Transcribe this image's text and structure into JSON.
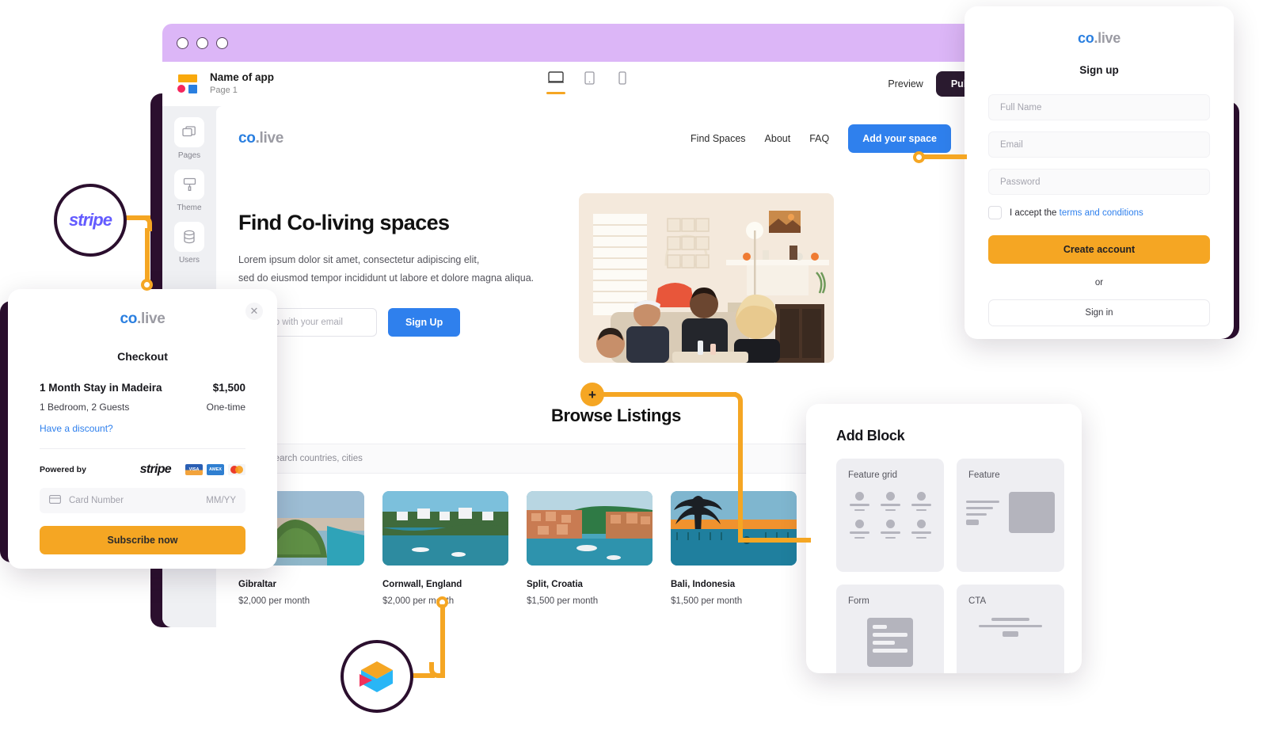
{
  "editor": {
    "window_controls": [
      "close",
      "minimize",
      "maximize"
    ],
    "app_name": "Name of app",
    "page_label": "Page 1",
    "devices": [
      {
        "name": "desktop",
        "active": true
      },
      {
        "name": "tablet",
        "active": false
      },
      {
        "name": "mobile",
        "active": false
      }
    ],
    "preview_label": "Preview",
    "publish_label": "Publish",
    "sidebar": [
      {
        "label": "Pages",
        "icon": "pages-icon"
      },
      {
        "label": "Theme",
        "icon": "theme-brush-icon"
      },
      {
        "label": "Users",
        "icon": "users-database-icon"
      }
    ]
  },
  "site": {
    "brand": {
      "co": "co",
      "live": ".live"
    },
    "nav": [
      {
        "label": "Find Spaces"
      },
      {
        "label": "About"
      },
      {
        "label": "FAQ"
      }
    ],
    "cta_label": "Add your space",
    "hero": {
      "heading": "Find Co-living spaces",
      "paragraph_line1": "Lorem ipsum dolor sit amet, consectetur adipiscing elit,",
      "paragraph_line2": "sed do eiusmod tempor incididunt ut labore et dolore magna aliqua.",
      "email_placeholder": "Sign up with your email",
      "signup_label": "Sign Up"
    },
    "browse": {
      "title": "Browse Listings",
      "search_placeholder": "Search countries, cities",
      "listings": [
        {
          "name": "Gibraltar",
          "price": "$2,000 per month"
        },
        {
          "name": "Cornwall, England",
          "price": "$2,000 per month"
        },
        {
          "name": "Split, Croatia",
          "price": "$1,500 per month"
        },
        {
          "name": "Bali, Indonesia",
          "price": "$1,500 per month"
        }
      ]
    }
  },
  "checkout": {
    "brand": {
      "co": "co",
      "live": ".live"
    },
    "close_icon": "close-icon",
    "title": "Checkout",
    "item_name": "1 Month Stay in Madeira",
    "item_price": "$1,500",
    "item_detail": "1 Bedroom, 2 Guests",
    "item_frequency": "One-time",
    "discount_link": "Have a discount?",
    "powered_by": "Powered by",
    "stripe_label": "stripe",
    "card_brands": [
      "VISA",
      "AMEX",
      "mastercard"
    ],
    "card_placeholder": "Card Number",
    "expiry_placeholder": "MM/YY",
    "subscribe_label": "Subscribe now"
  },
  "signup": {
    "brand": {
      "co": "co",
      "live": ".live"
    },
    "title": "Sign up",
    "fields": [
      {
        "placeholder": "Full Name"
      },
      {
        "placeholder": "Email"
      },
      {
        "placeholder": "Password"
      }
    ],
    "terms_prefix": "I accept the ",
    "terms_link": "terms and conditions",
    "create_label": "Create account",
    "or_label": "or",
    "signin_label": "Sign in"
  },
  "add_block": {
    "title": "Add Block",
    "blocks": [
      {
        "label": "Feature grid"
      },
      {
        "label": "Feature"
      },
      {
        "label": "Form"
      },
      {
        "label": "CTA"
      }
    ]
  },
  "badges": {
    "stripe_label": "stripe",
    "cube_icon": "cube-logo-icon",
    "plus_label": "+"
  },
  "colors": {
    "accent_orange": "#f5a623",
    "brand_blue": "#2f80ed",
    "title_bar_purple": "#dcb6f7",
    "dark_frame": "#2b0f2e",
    "stripe_purple": "#635bff"
  }
}
